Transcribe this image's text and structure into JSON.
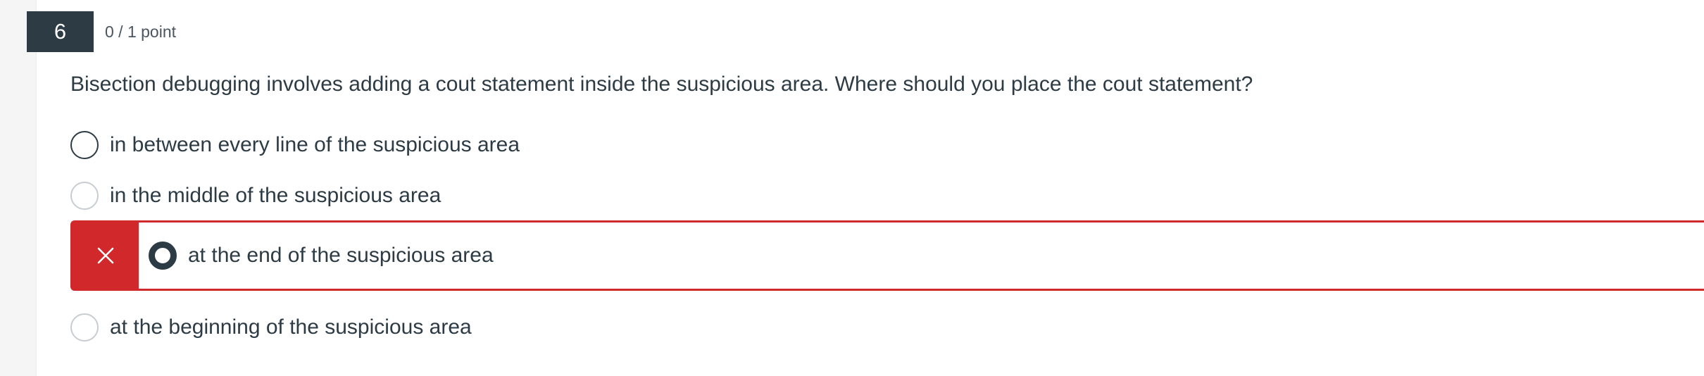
{
  "question": {
    "number": "6",
    "points": "0 / 1 point",
    "text": "Bisection debugging involves adding a cout statement inside the suspicious area. Where should you place the cout statement?"
  },
  "answers": [
    {
      "label": "in between every line of the suspicious area",
      "selected": false,
      "state": "unselected"
    },
    {
      "label": "in the middle of the suspicious area",
      "selected": false,
      "state": "unselected"
    },
    {
      "label": "at the end of the suspicious area",
      "selected": true,
      "state": "incorrect",
      "marker_icon": "close-icon"
    },
    {
      "label": "at the beginning of the suspicious area",
      "selected": false,
      "state": "unselected"
    }
  ],
  "colors": {
    "question_badge": "#2d3b45",
    "incorrect": "#d0282b",
    "text": "#2d3b45"
  }
}
